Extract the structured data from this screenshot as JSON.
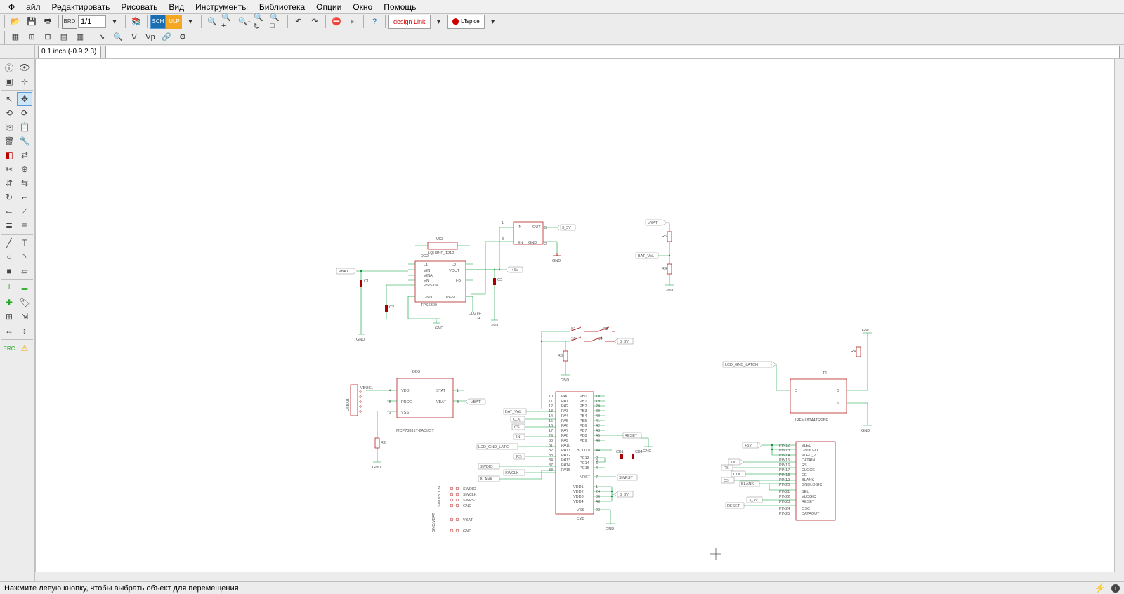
{
  "menu": {
    "file": "Файл",
    "edit": "Редактировать",
    "draw": "Рисовать",
    "view": "Вид",
    "tools": "Инструменты",
    "library": "Библиотека",
    "options": "Опции",
    "window": "Окно",
    "help": "Помощь"
  },
  "toolbar1": {
    "sheet_sel": "1/1",
    "design_link": "design Link",
    "ltspice": "LTspice"
  },
  "toolbar2": {
    "v_label": "V",
    "vp_label": "Vp"
  },
  "coord": {
    "value": "0.1 inch (-0.9 2.3)"
  },
  "components": {
    "u3": "U$3",
    "u3_foot": "LQH3NP_1212",
    "dd2": "DD2",
    "dd2_pins_left": [
      "L1",
      "VIN",
      "VINA",
      "EN",
      "PS/SYNC",
      "GND"
    ],
    "dd2_pins_right": [
      "L2",
      "VOUT",
      "FB",
      "PGND"
    ],
    "dd2_bottom": "TPS6300",
    "dd2th": "DD2TH",
    "th": "TH",
    "reg": {
      "name": "",
      "pins": [
        "IN",
        "OUT",
        "EN",
        "GND"
      ],
      "pin_nums": [
        "1",
        "5",
        "3",
        "2"
      ]
    },
    "dd3": "DD3",
    "dd3_pins_left": [
      "VDD",
      "PROG",
      "VSS"
    ],
    "dd3_pins_right": [
      "STAT",
      "VBAT"
    ],
    "dd3_bottom": "MCP73831T-2ACI/OT",
    "usb": "USBAB",
    "usb_pins": [
      "VBUS1",
      "",
      "",
      "",
      ""
    ],
    "x1_left_a": [
      "PA0",
      "PA1",
      "PA2",
      "PA3",
      "PA4",
      "PA5",
      "PA6",
      "PA7",
      "PA8",
      "PA9",
      "PA10",
      "PA11",
      "PA12",
      "PA13",
      "PA14",
      "PA15"
    ],
    "x1_right_a": [
      "PB0",
      "PB1",
      "PB2",
      "PB3",
      "PB4",
      "PB5",
      "PB6",
      "PB7",
      "PB8",
      "PB9",
      "BOOT0",
      "PC13",
      "PC14",
      "PC15",
      "NRST"
    ],
    "x1_bottom_left": [
      "VDD1",
      "VDD2",
      "VDD3",
      "VDD4",
      "",
      "VSS",
      "",
      "EXP"
    ],
    "t1": "T1",
    "t1_pins": [
      "D",
      "G",
      "S"
    ],
    "t1_foot": "IRFML8244TRPBF",
    "dd4_pins_right": [
      "VLED",
      "GNDLED",
      "VLED_2",
      "DATAIN",
      "RS",
      "CLOCK",
      "CE",
      "BLANK",
      "GNDLOGIC",
      "SEL",
      "VLOGIC",
      "RESET",
      "OSC",
      "DATAOUT"
    ],
    "dd4_pins_left": [
      "PIN12",
      "PIN13",
      "PIN14",
      "PIN15",
      "PIN16",
      "PIN17",
      "PIN18",
      "PIN19",
      "PIN20",
      "PIN21",
      "PIN22",
      "PIN23",
      "PIN24",
      "PIN25"
    ],
    "swd": [
      "SWDIO",
      "SWCLK",
      "SWRST",
      "GND",
      "",
      "VBAT",
      "",
      "GND"
    ],
    "swd_side": "SWD/BLCKL"
  },
  "nets": {
    "vbat": "VBAT",
    "v5": "+5V",
    "v33": "3_3V",
    "gnd": "GND",
    "bat_val": "BAT_VAL",
    "clk": "CLK",
    "cs": "CS",
    "in": "IN",
    "rs": "RS",
    "blank": "BLANK",
    "reset": "RESET",
    "swdio": "SWDIO",
    "swclk": "SWCLK",
    "swrst": "SWRST",
    "lcd_gnd_latch": "LCD_GND_LATCH",
    "gnd_vbat": "GND/VBAT"
  },
  "parts": {
    "c1": "C1",
    "c2": "C2",
    "c3": "C3",
    "r2": "R2",
    "r3": "R3",
    "r4": "R4",
    "r5": "R5",
    "s1": "S1",
    "s2": "S2",
    "s3": "S3",
    "s4": "S4",
    "cb1": "CB1",
    "cb4": "CB4"
  },
  "status": {
    "hint": "Нажмите левую кнопку, чтобы выбрать объект для перемещения"
  }
}
